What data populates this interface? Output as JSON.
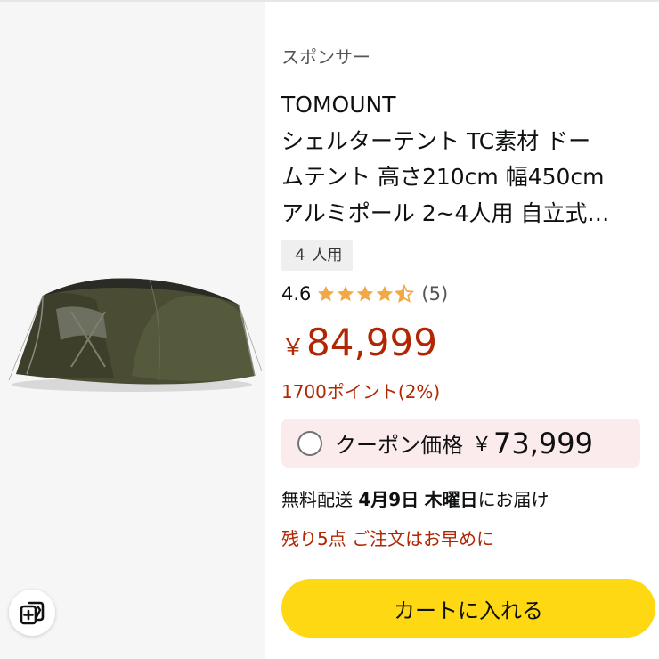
{
  "product": {
    "sponsor_label": "スポンサー",
    "title_lines": [
      "TOMOUNT",
      "シェルターテント TC素材 ドー",
      "ムテント 高さ210cm 幅450cm",
      "アルミポール 2~4人用 自立式…"
    ],
    "capacity_badge": "４ 人用",
    "rating": {
      "value": "4.6",
      "stars_out_of_5": 4.6,
      "count": "(5)"
    },
    "price": {
      "currency": "￥",
      "amount": "84,999"
    },
    "points": "1700ポイント(2%)",
    "coupon": {
      "label": "クーポン価格",
      "currency": "￥",
      "amount": "73,999",
      "checked": false
    },
    "delivery": {
      "prefix": "無料配送",
      "date": "4月9日",
      "weekday": "木曜日",
      "suffix": "にお届け"
    },
    "stock_message": "残り5点 ご注文はお早めに",
    "add_to_cart_label": "カートに入れる"
  },
  "icons": {
    "compare": "add-to-compare-icon",
    "star": "star-icon"
  },
  "colors": {
    "price": "#b12704",
    "star": "#f3a847",
    "cart_button": "#ffd814",
    "coupon_bg": "#fcebec"
  }
}
